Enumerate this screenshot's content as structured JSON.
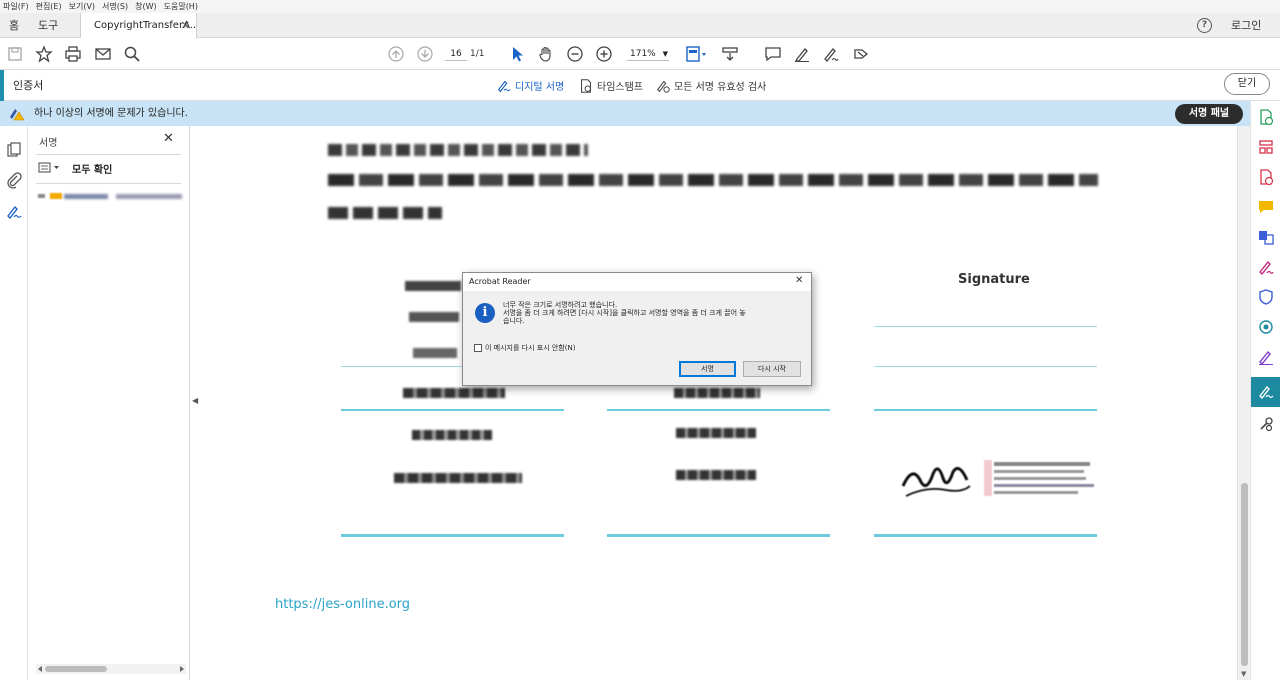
{
  "menu": [
    "파일(F)",
    "편집(E)",
    "보기(V)",
    "서명(S)",
    "창(W)",
    "도움말(H)"
  ],
  "tabs": {
    "home": "홈",
    "tools": "도구",
    "document": "CopyrightTransferA...",
    "login": "로그인"
  },
  "toolbar": {
    "page_current": "16",
    "page_total": "1/1",
    "zoom": "171%"
  },
  "cert_bar": {
    "title": "인증서",
    "digital_signature": "디지털 서명",
    "timestamp": "타임스탬프",
    "validate_all": "모든 서명 유효성 검사",
    "close": "닫기"
  },
  "signature_bar": {
    "message": "하나 이상의 서명에 문제가 있습니다.",
    "panel_button": "서명 패널"
  },
  "sidebar": {
    "title": "서명",
    "verify_all": "모두 확인"
  },
  "document": {
    "signature_header": "Signature",
    "url": "https://jes-online.org"
  },
  "dialog": {
    "title": "Acrobat Reader",
    "message_line1": "너무 작은 크기로 서명하려고 했습니다.",
    "message_line2": "서명을 좀 더 크게 하려면 [다시 시작]을 클릭하고 서명할 영역을 좀 더 크게 끌어 놓",
    "message_line3": "습니다.",
    "checkbox_label": "이 메시지를 다시 표시 안함(N)",
    "sign_button": "서명",
    "restart_button": "다시 시작"
  },
  "colors": {
    "accent": "#1e8aa0",
    "info_bar": "#c7e3f5",
    "link": "#29a3c8",
    "table_line": "#6ccbdc"
  }
}
